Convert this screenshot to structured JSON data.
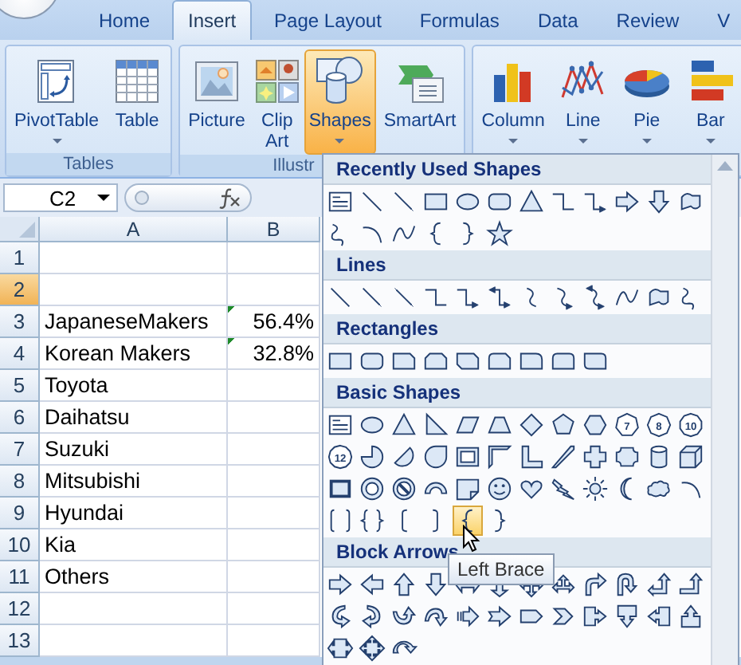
{
  "tabs": [
    {
      "label": "Home",
      "selected": false
    },
    {
      "label": "Insert",
      "selected": true
    },
    {
      "label": "Page Layout",
      "selected": false
    },
    {
      "label": "Formulas",
      "selected": false
    },
    {
      "label": "Data",
      "selected": false
    },
    {
      "label": "Review",
      "selected": false
    },
    {
      "label": "V",
      "selected": false
    }
  ],
  "ribbon_groups": [
    {
      "label": "Tables",
      "buttons": [
        {
          "kind": "pivot-table",
          "label": "PivotTable",
          "dropdown": true,
          "selected": false
        },
        {
          "kind": "table",
          "label": "Table",
          "dropdown": false,
          "selected": false
        }
      ]
    },
    {
      "label": "Illustr",
      "buttons": [
        {
          "kind": "picture",
          "label": "Picture",
          "dropdown": false,
          "selected": false
        },
        {
          "kind": "clip-art",
          "label": "Clip Art",
          "dropdown": false,
          "selected": false
        },
        {
          "kind": "shapes",
          "label": "Shapes",
          "dropdown": true,
          "selected": true
        },
        {
          "kind": "smartart",
          "label": "SmartArt",
          "dropdown": false,
          "selected": false
        }
      ]
    },
    {
      "buttons": [
        {
          "kind": "column-chart",
          "label": "Column",
          "dropdown": true,
          "selected": false
        },
        {
          "kind": "line-chart",
          "label": "Line",
          "dropdown": true,
          "selected": false
        },
        {
          "kind": "pie-chart",
          "label": "Pie",
          "dropdown": true,
          "selected": false
        },
        {
          "kind": "bar-chart",
          "label": "Bar",
          "dropdown": true,
          "selected": false
        }
      ]
    }
  ],
  "name_box": "C2",
  "columns": [
    "A",
    "B"
  ],
  "rows": [
    {
      "number": "1",
      "selected": false,
      "error_flag": false
    },
    {
      "number": "2",
      "selected": true,
      "error_flag": false
    },
    {
      "number": "3",
      "selected": false,
      "a": "JapaneseMakers",
      "b": "56.4%",
      "error_flag": true
    },
    {
      "number": "4",
      "selected": false,
      "a": "Korean Makers",
      "b": "32.8%",
      "error_flag": true
    },
    {
      "number": "5",
      "selected": false,
      "a": "Toyota",
      "error_flag": false
    },
    {
      "number": "6",
      "selected": false,
      "a": "Daihatsu",
      "error_flag": false
    },
    {
      "number": "7",
      "selected": false,
      "a": "Suzuki",
      "error_flag": false
    },
    {
      "number": "8",
      "selected": false,
      "a": "Mitsubishi",
      "error_flag": false
    },
    {
      "number": "9",
      "selected": false,
      "a": "Hyundai",
      "error_flag": false
    },
    {
      "number": "10",
      "selected": false,
      "a": "Kia",
      "error_flag": false
    },
    {
      "number": "11",
      "selected": false,
      "a": "Others",
      "error_flag": false
    },
    {
      "number": "12",
      "selected": false,
      "error_flag": false
    },
    {
      "number": "13",
      "selected": false,
      "error_flag": false
    }
  ],
  "shapes_menu": {
    "tooltip": "Left Brace",
    "sections": [
      {
        "title": "Recently Used Shapes",
        "items": [
          {
            "kind": "textbox",
            "selected": false
          },
          {
            "kind": "line",
            "selected": false
          },
          {
            "kind": "arrow-line",
            "selected": false
          },
          {
            "kind": "rect",
            "selected": false
          },
          {
            "kind": "oval",
            "selected": false
          },
          {
            "kind": "rounded-rect",
            "selected": false
          },
          {
            "kind": "triangle",
            "selected": false
          },
          {
            "kind": "elbow",
            "selected": false
          },
          {
            "kind": "elbow-arrow",
            "selected": false
          },
          {
            "kind": "right-arrow",
            "selected": false
          },
          {
            "kind": "down-arrow",
            "selected": false
          },
          {
            "kind": "freeform",
            "selected": false
          },
          {
            "kind": "scribble",
            "selected": false
          },
          {
            "kind": "arc",
            "selected": false
          },
          {
            "kind": "curve",
            "selected": false
          },
          {
            "kind": "left-brace",
            "selected": false
          },
          {
            "kind": "right-brace",
            "selected": false
          },
          {
            "kind": "star",
            "selected": false
          }
        ]
      },
      {
        "title": "Lines",
        "items": [
          {
            "kind": "line",
            "selected": false
          },
          {
            "kind": "arrow-line",
            "selected": false
          },
          {
            "kind": "double-arrow-line",
            "selected": false
          },
          {
            "kind": "elbow",
            "selected": false
          },
          {
            "kind": "elbow-arrow",
            "selected": false
          },
          {
            "kind": "elbow-double-arrow",
            "selected": false
          },
          {
            "kind": "curved-connector",
            "selected": false
          },
          {
            "kind": "curved-arrow-connector",
            "selected": false
          },
          {
            "kind": "curved-double-arrow-connector",
            "selected": false
          },
          {
            "kind": "curve",
            "selected": false
          },
          {
            "kind": "freeform",
            "selected": false
          },
          {
            "kind": "scribble",
            "selected": false
          }
        ]
      },
      {
        "title": "Rectangles",
        "items": [
          {
            "kind": "rect",
            "selected": false
          },
          {
            "kind": "rounded-rect",
            "selected": false
          },
          {
            "kind": "snip-corner",
            "selected": false
          },
          {
            "kind": "snip-top",
            "selected": false
          },
          {
            "kind": "snip-diagonal",
            "selected": false
          },
          {
            "kind": "snip-round",
            "selected": false
          },
          {
            "kind": "round-corner",
            "selected": false
          },
          {
            "kind": "round-top",
            "selected": false
          },
          {
            "kind": "round-diagonal",
            "selected": false
          }
        ]
      },
      {
        "title": "Basic Shapes",
        "items": [
          {
            "kind": "textbox",
            "selected": false
          },
          {
            "kind": "oval",
            "selected": false
          },
          {
            "kind": "triangle",
            "selected": false
          },
          {
            "kind": "right-triangle",
            "selected": false
          },
          {
            "kind": "parallelogram",
            "selected": false
          },
          {
            "kind": "trapezoid",
            "selected": false
          },
          {
            "kind": "diamond",
            "selected": false
          },
          {
            "kind": "pentagon",
            "selected": false
          },
          {
            "kind": "hexagon",
            "selected": false
          },
          {
            "kind": "heptagon",
            "label": "7",
            "selected": false
          },
          {
            "kind": "octagon",
            "label": "8",
            "selected": false
          },
          {
            "kind": "decagon",
            "label": "10",
            "selected": false
          },
          {
            "kind": "dodecagon",
            "label": "12",
            "selected": false
          },
          {
            "kind": "pie",
            "selected": false
          },
          {
            "kind": "chord",
            "selected": false
          },
          {
            "kind": "teardrop",
            "selected": false
          },
          {
            "kind": "frame",
            "selected": false
          },
          {
            "kind": "half-frame",
            "selected": false
          },
          {
            "kind": "l-shape",
            "selected": false
          },
          {
            "kind": "diagonal-stripe",
            "selected": false
          },
          {
            "kind": "cross",
            "selected": false
          },
          {
            "kind": "plaque",
            "selected": false
          },
          {
            "kind": "can",
            "selected": false
          },
          {
            "kind": "cube",
            "selected": false
          },
          {
            "kind": "bevel",
            "selected": false
          },
          {
            "kind": "donut",
            "selected": false
          },
          {
            "kind": "no-symbol",
            "selected": false
          },
          {
            "kind": "block-arc",
            "selected": false
          },
          {
            "kind": "folded-corner",
            "selected": false
          },
          {
            "kind": "smiley",
            "selected": false
          },
          {
            "kind": "heart",
            "selected": false
          },
          {
            "kind": "lightning",
            "selected": false
          },
          {
            "kind": "sun",
            "selected": false
          },
          {
            "kind": "moon",
            "selected": false
          },
          {
            "kind": "cloud",
            "selected": false
          },
          {
            "kind": "arc",
            "selected": false
          },
          {
            "kind": "double-bracket",
            "selected": false
          },
          {
            "kind": "double-brace",
            "selected": false
          },
          {
            "kind": "left-bracket",
            "selected": false
          },
          {
            "kind": "right-bracket",
            "selected": false
          },
          {
            "kind": "left-brace",
            "selected": true
          },
          {
            "kind": "right-brace",
            "selected": false
          }
        ]
      },
      {
        "title": "Block Arrows",
        "items": [
          {
            "kind": "right-arrow",
            "selected": false
          },
          {
            "kind": "left-arrow",
            "selected": false
          },
          {
            "kind": "up-arrow",
            "selected": false
          },
          {
            "kind": "down-arrow",
            "selected": false
          },
          {
            "kind": "left-right-arrow",
            "selected": false
          },
          {
            "kind": "up-down-arrow",
            "selected": false
          },
          {
            "kind": "quad-arrow",
            "selected": false
          },
          {
            "kind": "left-right-up-arrow",
            "selected": false
          },
          {
            "kind": "bent-arrow",
            "selected": false
          },
          {
            "kind": "u-turn-arrow",
            "selected": false
          },
          {
            "kind": "left-up-arrow",
            "selected": false
          },
          {
            "kind": "bent-up-arrow",
            "selected": false
          },
          {
            "kind": "curved-right-arrow",
            "selected": false
          },
          {
            "kind": "curved-left-arrow",
            "selected": false
          },
          {
            "kind": "curved-up-arrow",
            "selected": false
          },
          {
            "kind": "curved-down-arrow",
            "selected": false
          },
          {
            "kind": "striped-right-arrow",
            "selected": false
          },
          {
            "kind": "notched-right-arrow",
            "selected": false
          },
          {
            "kind": "home-plate",
            "selected": false
          },
          {
            "kind": "chevron",
            "selected": false
          },
          {
            "kind": "right-arrow-callout",
            "selected": false
          },
          {
            "kind": "down-arrow-callout",
            "selected": false
          },
          {
            "kind": "left-arrow-callout",
            "selected": false
          },
          {
            "kind": "up-arrow-callout",
            "selected": false
          },
          {
            "kind": "left-right-arrow-callout",
            "selected": false
          },
          {
            "kind": "quad-arrow-callout",
            "selected": false
          },
          {
            "kind": "circular-arrow",
            "selected": false
          }
        ]
      }
    ]
  }
}
